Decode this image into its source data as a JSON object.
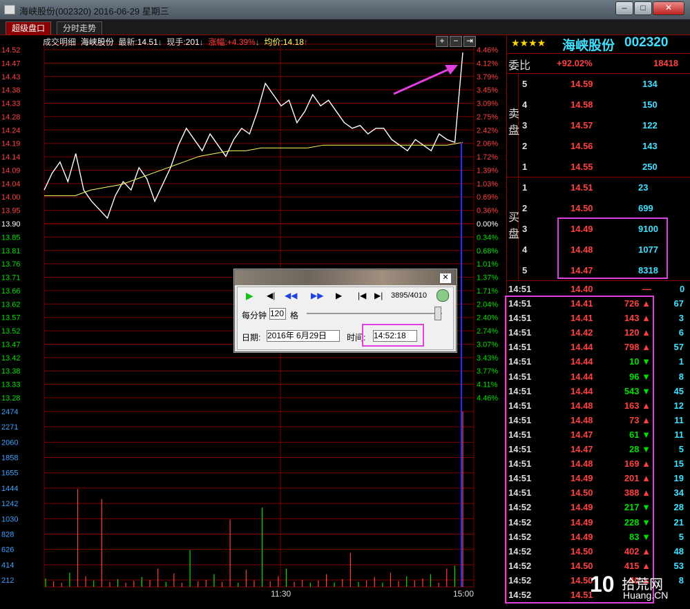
{
  "window": {
    "title": "海峡股份(002320) 2016-06-29 星期三"
  },
  "tabs": [
    {
      "label": "超级盘口"
    },
    {
      "label": "分时走势"
    }
  ],
  "info": {
    "detail": "成交明细",
    "name": "海峡股份",
    "latest_label": "最新:",
    "latest": "14.51",
    "vol_label": "现手:",
    "vol": "201",
    "chg_label": "涨幅:",
    "chg": "+4.39%",
    "avg_label": "均价:",
    "avg": "14.18"
  },
  "chart_data": {
    "type": "line",
    "x_start_label": "",
    "xticks": [
      "11:30",
      "15:00"
    ],
    "price_ticks": [
      "14.52",
      "14.47",
      "14.43",
      "14.38",
      "14.33",
      "14.28",
      "14.24",
      "14.19",
      "14.14",
      "14.09",
      "14.04",
      "14.00",
      "13.95",
      "13.90",
      "13.85",
      "13.81",
      "13.76",
      "13.71",
      "13.66",
      "13.62",
      "13.57",
      "13.52",
      "13.47",
      "13.42",
      "13.38",
      "13.33",
      "13.28"
    ],
    "pct_ticks": [
      "4.46%",
      "4.12%",
      "3.79%",
      "3.45%",
      "3.09%",
      "2.75%",
      "2.42%",
      "2.06%",
      "1.72%",
      "1.39%",
      "1.03%",
      "0.69%",
      "0.36%",
      "0.00%",
      "0.34%",
      "0.68%",
      "1.01%",
      "1.37%",
      "1.71%",
      "2.04%",
      "2.40%",
      "2.74%",
      "3.07%",
      "3.43%",
      "3.77%",
      "4.11%",
      "4.46%"
    ],
    "volume_ticks": [
      "2474",
      "2271",
      "2060",
      "1858",
      "1655",
      "1444",
      "1242",
      "1030",
      "828",
      "626",
      "414",
      "212"
    ],
    "prev_close": 13.9,
    "price_range": [
      13.28,
      14.52
    ],
    "volume_max": 2474,
    "price_series": [
      14.02,
      14.08,
      14.12,
      14.05,
      14.15,
      14.02,
      13.98,
      13.95,
      13.92,
      14.0,
      14.05,
      14.02,
      14.1,
      14.06,
      13.98,
      14.04,
      14.1,
      14.18,
      14.24,
      14.2,
      14.16,
      14.22,
      14.18,
      14.14,
      14.2,
      14.24,
      14.22,
      14.3,
      14.4,
      14.36,
      14.32,
      14.34,
      14.26,
      14.3,
      14.36,
      14.32,
      14.34,
      14.3,
      14.26,
      14.24,
      14.25,
      14.22,
      14.24,
      14.24,
      14.2,
      14.18,
      14.16,
      14.2,
      14.18,
      14.16,
      14.22,
      14.2,
      14.19,
      14.51
    ],
    "avg_series": [
      14.0,
      14.0,
      14.0,
      14.02,
      14.03,
      14.04,
      14.06,
      14.08,
      14.1,
      14.12,
      14.14,
      14.15,
      14.16,
      14.16,
      14.17,
      14.17,
      14.17,
      14.17,
      14.18,
      14.18,
      14.18,
      14.18,
      14.18,
      14.18,
      14.18,
      14.18,
      14.18,
      14.19
    ],
    "volume_series": [
      120,
      80,
      60,
      200,
      1380,
      150,
      90,
      1240,
      70,
      110,
      60,
      85,
      140,
      95,
      260,
      70,
      190,
      60,
      520,
      80,
      100,
      180,
      70,
      950,
      60,
      240,
      90,
      1120,
      80,
      150,
      260,
      70,
      100,
      60,
      90,
      180,
      60,
      110,
      480,
      70,
      90,
      140,
      60,
      200,
      80,
      150,
      90,
      120,
      180,
      60,
      260,
      300,
      2474
    ]
  },
  "panel": {
    "stars": "★★★★",
    "stock_name": "海峡股份",
    "stock_code": "002320",
    "weibi_label": "委比",
    "weibi_pct": "+92.02%",
    "weibi_val": "18418",
    "sell_label": "卖盘",
    "buy_label": "买盘",
    "sell": [
      {
        "lvl": "5",
        "price": "14.59",
        "vol": "134"
      },
      {
        "lvl": "4",
        "price": "14.58",
        "vol": "150"
      },
      {
        "lvl": "3",
        "price": "14.57",
        "vol": "122"
      },
      {
        "lvl": "2",
        "price": "14.56",
        "vol": "143"
      },
      {
        "lvl": "1",
        "price": "14.55",
        "vol": "250"
      }
    ],
    "buy": [
      {
        "lvl": "1",
        "price": "14.51",
        "vol": "23"
      },
      {
        "lvl": "2",
        "price": "14.50",
        "vol": "699"
      },
      {
        "lvl": "3",
        "price": "14.49",
        "vol": "9100"
      },
      {
        "lvl": "4",
        "price": "14.48",
        "vol": "1077"
      },
      {
        "lvl": "5",
        "price": "14.47",
        "vol": "8318"
      }
    ],
    "first_trade": {
      "time": "14:51",
      "price": "14.40",
      "vol": "—",
      "count": "0"
    },
    "trades": [
      {
        "time": "14:51",
        "price": "14.41",
        "vol": "726",
        "dir": "up",
        "count": "67"
      },
      {
        "time": "14:51",
        "price": "14.41",
        "vol": "143",
        "dir": "up",
        "count": "3"
      },
      {
        "time": "14:51",
        "price": "14.42",
        "vol": "120",
        "dir": "up",
        "count": "6"
      },
      {
        "time": "14:51",
        "price": "14.44",
        "vol": "798",
        "dir": "up",
        "count": "57"
      },
      {
        "time": "14:51",
        "price": "14.44",
        "vol": "10",
        "dir": "down",
        "count": "1"
      },
      {
        "time": "14:51",
        "price": "14.44",
        "vol": "96",
        "dir": "down",
        "count": "8"
      },
      {
        "time": "14:51",
        "price": "14.44",
        "vol": "543",
        "dir": "down",
        "count": "45"
      },
      {
        "time": "14:51",
        "price": "14.48",
        "vol": "163",
        "dir": "up",
        "count": "12"
      },
      {
        "time": "14:51",
        "price": "14.48",
        "vol": "73",
        "dir": "up",
        "count": "11"
      },
      {
        "time": "14:51",
        "price": "14.47",
        "vol": "61",
        "dir": "down",
        "count": "11"
      },
      {
        "time": "14:51",
        "price": "14.47",
        "vol": "28",
        "dir": "down",
        "count": "5"
      },
      {
        "time": "14:51",
        "price": "14.48",
        "vol": "169",
        "dir": "up",
        "count": "15"
      },
      {
        "time": "14:51",
        "price": "14.49",
        "vol": "201",
        "dir": "up",
        "count": "19"
      },
      {
        "time": "14:51",
        "price": "14.50",
        "vol": "388",
        "dir": "up",
        "count": "34"
      },
      {
        "time": "14:52",
        "price": "14.49",
        "vol": "217",
        "dir": "down",
        "count": "28"
      },
      {
        "time": "14:52",
        "price": "14.49",
        "vol": "228",
        "dir": "down",
        "count": "21"
      },
      {
        "time": "14:52",
        "price": "14.49",
        "vol": "83",
        "dir": "down",
        "count": "5"
      },
      {
        "time": "14:52",
        "price": "14.50",
        "vol": "402",
        "dir": "up",
        "count": "48"
      },
      {
        "time": "14:52",
        "price": "14.50",
        "vol": "415",
        "dir": "up",
        "count": "53"
      },
      {
        "time": "14:52",
        "price": "14.50",
        "vol": "40",
        "dir": "up",
        "count": "8"
      },
      {
        "time": "14:52",
        "price": "14.51",
        "vol": "",
        "dir": "up",
        "count": ""
      }
    ]
  },
  "dialog": {
    "counter": "3895/4010",
    "per_min_label": "每分钟",
    "per_min_val": "120",
    "per_min_unit": "格",
    "date_label": "日期:",
    "date_val": "2016年 6月29日",
    "time_label": "时间:",
    "time_val": "14:52:18"
  },
  "watermark": {
    "text": "拾荒网",
    "sub": "Huang.CN"
  },
  "colors": {
    "up": "#ff4040",
    "down": "#00e000",
    "accent": "#e040e0",
    "grid": "#800000",
    "price": "#ffffff",
    "avg": "#ffff60",
    "cyan": "#40e0ff"
  }
}
